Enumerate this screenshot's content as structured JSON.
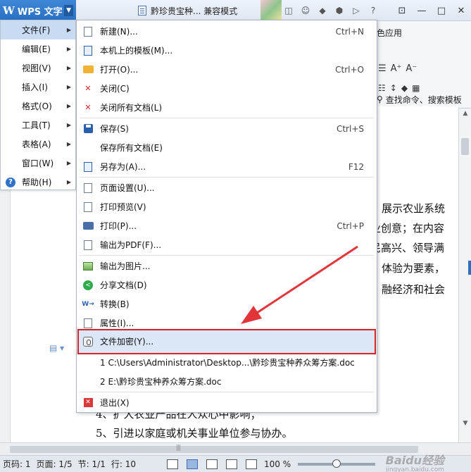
{
  "titlebar": {
    "app_name": "WPS 文字",
    "logo": "W",
    "document_tab": "黔珍贵宝种... 兼容模式",
    "icons": [
      "skin-icon",
      "gift-icon",
      "mail-icon",
      "cube-icon",
      "pen-icon",
      "help-icon"
    ]
  },
  "toolbar_right": {
    "partial_text": "色应用",
    "search_text": "查找命令、搜索模板",
    "font_buttons": [
      "A⁺",
      "A⁻"
    ]
  },
  "main_menu": {
    "items": [
      {
        "label": "文件(F)",
        "active": true
      },
      {
        "label": "编辑(E)"
      },
      {
        "label": "视图(V)"
      },
      {
        "label": "插入(I)"
      },
      {
        "label": "格式(O)"
      },
      {
        "label": "工具(T)"
      },
      {
        "label": "表格(A)"
      },
      {
        "label": "窗口(W)"
      },
      {
        "label": "帮助(H)"
      }
    ]
  },
  "file_menu": {
    "items": [
      {
        "label": "新建(N)...",
        "shortcut": "Ctrl+N"
      },
      {
        "label": "本机上的模板(M)...",
        "shortcut": ""
      },
      {
        "label": "打开(O)...",
        "shortcut": "Ctrl+O"
      },
      {
        "label": "关闭(C)",
        "shortcut": ""
      },
      {
        "label": "关闭所有文档(L)",
        "shortcut": ""
      },
      {
        "label": "保存(S)",
        "shortcut": "Ctrl+S"
      },
      {
        "label": "保存所有文档(E)",
        "shortcut": ""
      },
      {
        "label": "另存为(A)...",
        "shortcut": "F12"
      },
      {
        "label": "页面设置(U)...",
        "shortcut": ""
      },
      {
        "label": "打印预览(V)",
        "shortcut": ""
      },
      {
        "label": "打印(P)...",
        "shortcut": "Ctrl+P"
      },
      {
        "label": "输出为PDF(F)...",
        "shortcut": ""
      },
      {
        "label": "输出为图片...",
        "shortcut": ""
      },
      {
        "label": "分享文档(D)",
        "shortcut": ""
      },
      {
        "label": "转换(B)",
        "shortcut": ""
      },
      {
        "label": "属性(I)...",
        "shortcut": ""
      },
      {
        "label": "文件加密(Y)...",
        "shortcut": ""
      },
      {
        "label": "1 C:\\Users\\Administrator\\Desktop...\\黔珍贵宝种养众筹方案.doc",
        "shortcut": ""
      },
      {
        "label": "2 E:\\黔珍贵宝种养众筹方案.doc",
        "shortcut": ""
      },
      {
        "label": "退出(X)",
        "shortcut": ""
      }
    ]
  },
  "document": {
    "lines": [
      "展示农业系统",
      "业创意；在内容",
      "民高兴、领导满",
      "体验为要素，",
      "融经济和社会",
      "4、扩大农业产品在人众心中影响；",
      "5、引进以家庭或机关事业单位参与协办。"
    ]
  },
  "statusbar": {
    "page_code": "页码: 1",
    "page": "页面: 1/5",
    "section": "节: 1/1",
    "row": "行: 10",
    "zoom": "100 %",
    "zoom_level": 0.5
  },
  "watermark": {
    "text": "Baidu经验",
    "url": "jingyan.baidu.com"
  },
  "colors": {
    "accent": "#2a6fc2",
    "highlight_border": "#d4262a",
    "menu_active": "#c8dbf3"
  }
}
